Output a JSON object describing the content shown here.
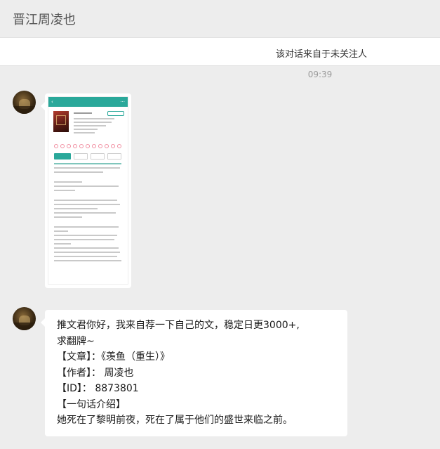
{
  "header": {
    "title": "晋江周凌也"
  },
  "notice": {
    "text": "该对话来自于未关注人"
  },
  "timestamp": "09:39",
  "messages": [
    {
      "type": "image",
      "sender_avatar_icon": "user-avatar-icon",
      "image_desc_icon": "novel-page-screenshot-icon"
    },
    {
      "type": "text",
      "sender_avatar_icon": "user-avatar-icon",
      "lines": [
        "推文君你好，我来自荐一下自己的文，稳定日更3000+,",
        "求翻牌~",
        "【文章】：《羡鱼（重生）》",
        "【作者】：  周凌也",
        "【ID】：  8873801",
        "【一句话介绍】",
        "她死在了黎明前夜，死在了属于他们的盛世来临之前。"
      ]
    }
  ],
  "colors": {
    "background": "#ededed",
    "bubble": "#ffffff",
    "header_text": "#555555",
    "timestamp": "#9a9a9a",
    "screenshot_accent": "#2aa89a"
  }
}
